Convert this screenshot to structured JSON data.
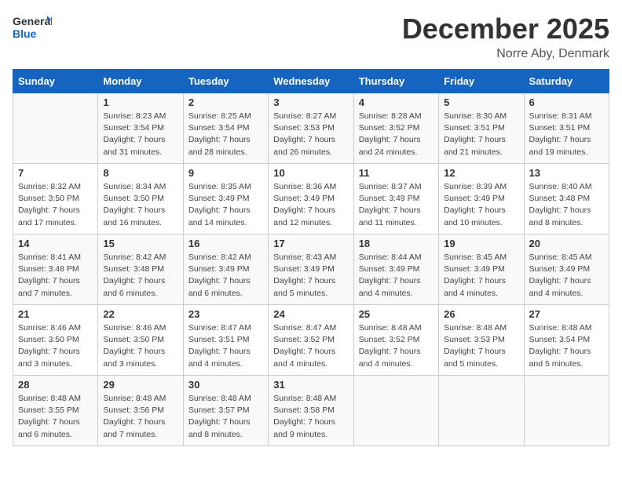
{
  "header": {
    "logo_general": "General",
    "logo_blue": "Blue",
    "month_title": "December 2025",
    "location": "Norre Aby, Denmark"
  },
  "weekdays": [
    "Sunday",
    "Monday",
    "Tuesday",
    "Wednesday",
    "Thursday",
    "Friday",
    "Saturday"
  ],
  "weeks": [
    [
      {
        "day": "",
        "sunrise": "",
        "sunset": "",
        "daylight": ""
      },
      {
        "day": "1",
        "sunrise": "Sunrise: 8:23 AM",
        "sunset": "Sunset: 3:54 PM",
        "daylight": "Daylight: 7 hours and 31 minutes."
      },
      {
        "day": "2",
        "sunrise": "Sunrise: 8:25 AM",
        "sunset": "Sunset: 3:54 PM",
        "daylight": "Daylight: 7 hours and 28 minutes."
      },
      {
        "day": "3",
        "sunrise": "Sunrise: 8:27 AM",
        "sunset": "Sunset: 3:53 PM",
        "daylight": "Daylight: 7 hours and 26 minutes."
      },
      {
        "day": "4",
        "sunrise": "Sunrise: 8:28 AM",
        "sunset": "Sunset: 3:52 PM",
        "daylight": "Daylight: 7 hours and 24 minutes."
      },
      {
        "day": "5",
        "sunrise": "Sunrise: 8:30 AM",
        "sunset": "Sunset: 3:51 PM",
        "daylight": "Daylight: 7 hours and 21 minutes."
      },
      {
        "day": "6",
        "sunrise": "Sunrise: 8:31 AM",
        "sunset": "Sunset: 3:51 PM",
        "daylight": "Daylight: 7 hours and 19 minutes."
      }
    ],
    [
      {
        "day": "7",
        "sunrise": "Sunrise: 8:32 AM",
        "sunset": "Sunset: 3:50 PM",
        "daylight": "Daylight: 7 hours and 17 minutes."
      },
      {
        "day": "8",
        "sunrise": "Sunrise: 8:34 AM",
        "sunset": "Sunset: 3:50 PM",
        "daylight": "Daylight: 7 hours and 16 minutes."
      },
      {
        "day": "9",
        "sunrise": "Sunrise: 8:35 AM",
        "sunset": "Sunset: 3:49 PM",
        "daylight": "Daylight: 7 hours and 14 minutes."
      },
      {
        "day": "10",
        "sunrise": "Sunrise: 8:36 AM",
        "sunset": "Sunset: 3:49 PM",
        "daylight": "Daylight: 7 hours and 12 minutes."
      },
      {
        "day": "11",
        "sunrise": "Sunrise: 8:37 AM",
        "sunset": "Sunset: 3:49 PM",
        "daylight": "Daylight: 7 hours and 11 minutes."
      },
      {
        "day": "12",
        "sunrise": "Sunrise: 8:39 AM",
        "sunset": "Sunset: 3:49 PM",
        "daylight": "Daylight: 7 hours and 10 minutes."
      },
      {
        "day": "13",
        "sunrise": "Sunrise: 8:40 AM",
        "sunset": "Sunset: 3:48 PM",
        "daylight": "Daylight: 7 hours and 8 minutes."
      }
    ],
    [
      {
        "day": "14",
        "sunrise": "Sunrise: 8:41 AM",
        "sunset": "Sunset: 3:48 PM",
        "daylight": "Daylight: 7 hours and 7 minutes."
      },
      {
        "day": "15",
        "sunrise": "Sunrise: 8:42 AM",
        "sunset": "Sunset: 3:48 PM",
        "daylight": "Daylight: 7 hours and 6 minutes."
      },
      {
        "day": "16",
        "sunrise": "Sunrise: 8:42 AM",
        "sunset": "Sunset: 3:49 PM",
        "daylight": "Daylight: 7 hours and 6 minutes."
      },
      {
        "day": "17",
        "sunrise": "Sunrise: 8:43 AM",
        "sunset": "Sunset: 3:49 PM",
        "daylight": "Daylight: 7 hours and 5 minutes."
      },
      {
        "day": "18",
        "sunrise": "Sunrise: 8:44 AM",
        "sunset": "Sunset: 3:49 PM",
        "daylight": "Daylight: 7 hours and 4 minutes."
      },
      {
        "day": "19",
        "sunrise": "Sunrise: 8:45 AM",
        "sunset": "Sunset: 3:49 PM",
        "daylight": "Daylight: 7 hours and 4 minutes."
      },
      {
        "day": "20",
        "sunrise": "Sunrise: 8:45 AM",
        "sunset": "Sunset: 3:49 PM",
        "daylight": "Daylight: 7 hours and 4 minutes."
      }
    ],
    [
      {
        "day": "21",
        "sunrise": "Sunrise: 8:46 AM",
        "sunset": "Sunset: 3:50 PM",
        "daylight": "Daylight: 7 hours and 3 minutes."
      },
      {
        "day": "22",
        "sunrise": "Sunrise: 8:46 AM",
        "sunset": "Sunset: 3:50 PM",
        "daylight": "Daylight: 7 hours and 3 minutes."
      },
      {
        "day": "23",
        "sunrise": "Sunrise: 8:47 AM",
        "sunset": "Sunset: 3:51 PM",
        "daylight": "Daylight: 7 hours and 4 minutes."
      },
      {
        "day": "24",
        "sunrise": "Sunrise: 8:47 AM",
        "sunset": "Sunset: 3:52 PM",
        "daylight": "Daylight: 7 hours and 4 minutes."
      },
      {
        "day": "25",
        "sunrise": "Sunrise: 8:48 AM",
        "sunset": "Sunset: 3:52 PM",
        "daylight": "Daylight: 7 hours and 4 minutes."
      },
      {
        "day": "26",
        "sunrise": "Sunrise: 8:48 AM",
        "sunset": "Sunset: 3:53 PM",
        "daylight": "Daylight: 7 hours and 5 minutes."
      },
      {
        "day": "27",
        "sunrise": "Sunrise: 8:48 AM",
        "sunset": "Sunset: 3:54 PM",
        "daylight": "Daylight: 7 hours and 5 minutes."
      }
    ],
    [
      {
        "day": "28",
        "sunrise": "Sunrise: 8:48 AM",
        "sunset": "Sunset: 3:55 PM",
        "daylight": "Daylight: 7 hours and 6 minutes."
      },
      {
        "day": "29",
        "sunrise": "Sunrise: 8:48 AM",
        "sunset": "Sunset: 3:56 PM",
        "daylight": "Daylight: 7 hours and 7 minutes."
      },
      {
        "day": "30",
        "sunrise": "Sunrise: 8:48 AM",
        "sunset": "Sunset: 3:57 PM",
        "daylight": "Daylight: 7 hours and 8 minutes."
      },
      {
        "day": "31",
        "sunrise": "Sunrise: 8:48 AM",
        "sunset": "Sunset: 3:58 PM",
        "daylight": "Daylight: 7 hours and 9 minutes."
      },
      {
        "day": "",
        "sunrise": "",
        "sunset": "",
        "daylight": ""
      },
      {
        "day": "",
        "sunrise": "",
        "sunset": "",
        "daylight": ""
      },
      {
        "day": "",
        "sunrise": "",
        "sunset": "",
        "daylight": ""
      }
    ]
  ]
}
